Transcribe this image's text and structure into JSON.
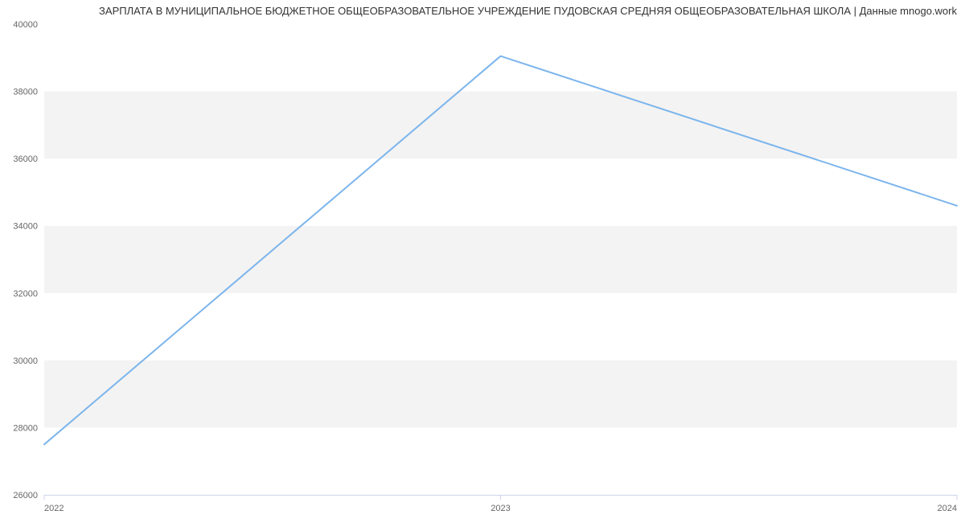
{
  "chart_data": {
    "type": "line",
    "title": "ЗАРПЛАТА В МУНИЦИПАЛЬНОЕ БЮДЖЕТНОЕ ОБЩЕОБРАЗОВАТЕЛЬНОЕ УЧРЕЖДЕНИЕ ПУДОВСКАЯ СРЕДНЯЯ ОБЩЕОБРАЗОВАТЕЛЬНАЯ ШКОЛА | Данные mnogo.work",
    "x": [
      2022,
      2023,
      2024
    ],
    "values": [
      27500,
      39050,
      34600
    ],
    "xlabel": "",
    "ylabel": "",
    "xlim": [
      2022,
      2024
    ],
    "ylim": [
      26000,
      40000
    ],
    "x_ticks": [
      "2022",
      "2023",
      "2024"
    ],
    "y_ticks": [
      "26000",
      "28000",
      "30000",
      "32000",
      "34000",
      "36000",
      "38000",
      "40000"
    ],
    "grid": true,
    "legend": false,
    "colors": {
      "line": "#7cb5ec",
      "band": "#f3f3f3",
      "axis": "#ccd6eb",
      "tick_text": "#666666"
    }
  }
}
